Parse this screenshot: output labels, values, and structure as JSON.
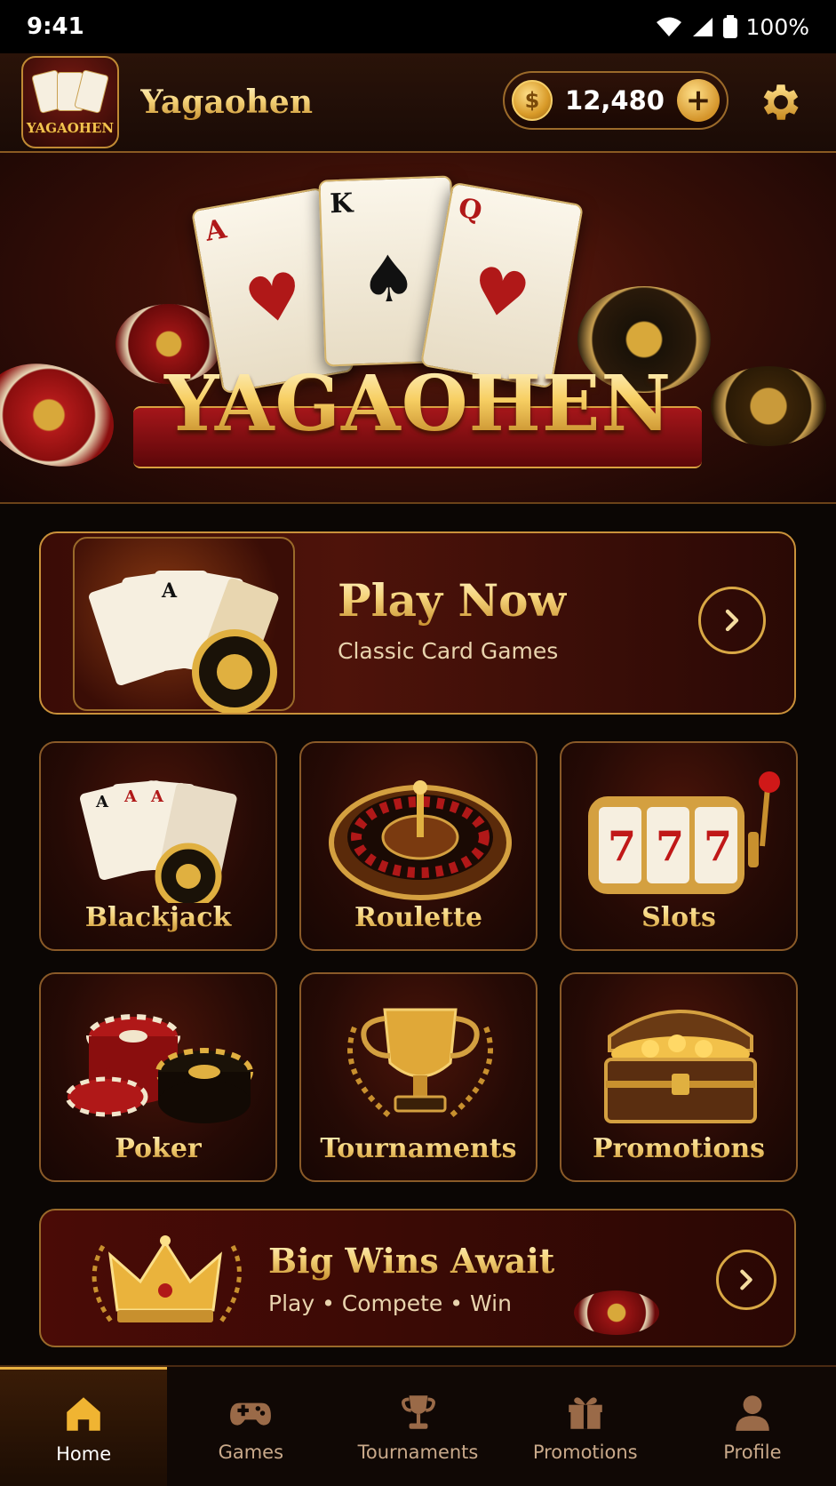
{
  "status_bar": {
    "time": "9:41",
    "battery": "100%"
  },
  "header": {
    "app_name": "Yagaohen",
    "app_icon_text": "YAGAOHEN",
    "coin_balance": "12,480"
  },
  "hero": {
    "title": "YAGAOHEN"
  },
  "play_now": {
    "title": "Play Now",
    "subtitle": "Classic Card Games"
  },
  "games": [
    {
      "label": "Blackjack"
    },
    {
      "label": "Roulette"
    },
    {
      "label": "Slots"
    },
    {
      "label": "Poker"
    },
    {
      "label": "Tournaments"
    },
    {
      "label": "Promotions"
    }
  ],
  "big_wins": {
    "title": "Big Wins Await",
    "subtitle": "Play • Compete • Win"
  },
  "nav": [
    {
      "label": "Home",
      "icon": "home-icon",
      "active": true
    },
    {
      "label": "Games",
      "icon": "gamepad-icon"
    },
    {
      "label": "Tournaments",
      "icon": "trophy-icon"
    },
    {
      "label": "Promotions",
      "icon": "gift-icon"
    },
    {
      "label": "Profile",
      "icon": "profile-icon"
    }
  ],
  "colors": {
    "gold": "#e8b040",
    "dark_red": "#3a0c06",
    "background": "#0b0604"
  }
}
